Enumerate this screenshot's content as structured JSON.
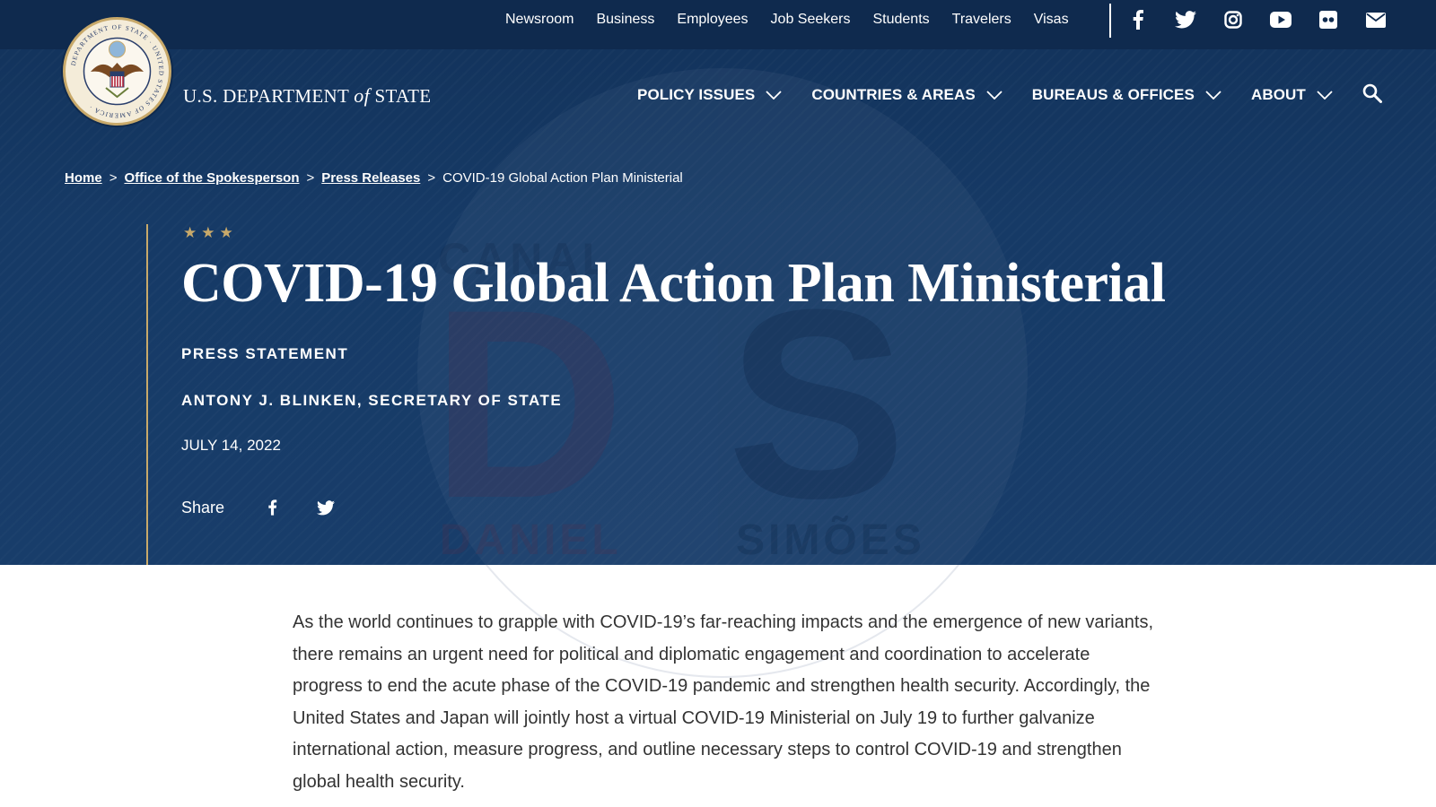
{
  "top_nav": {
    "links": [
      "Newsroom",
      "Business",
      "Employees",
      "Job Seekers",
      "Students",
      "Travelers",
      "Visas"
    ],
    "social_icons": [
      "facebook-icon",
      "twitter-icon",
      "instagram-icon",
      "youtube-icon",
      "flickr-icon",
      "email-icon"
    ]
  },
  "header": {
    "agency_part1": "U.S. DEPARTMENT",
    "agency_of": "of",
    "agency_part2": "STATE",
    "seal_text": "DEPARTMENT OF STATE · UNITED STATES OF AMERICA"
  },
  "main_nav": {
    "items": [
      "POLICY ISSUES",
      "COUNTRIES & AREAS",
      "BUREAUS & OFFICES",
      "ABOUT"
    ],
    "search_icon": "search-icon"
  },
  "breadcrumb": {
    "items": [
      "Home",
      "Office of the Spokesperson",
      "Press Releases"
    ],
    "current": "COVID-19 Global Action Plan Ministerial",
    "separator": ">"
  },
  "article": {
    "stars": "★★★",
    "title": "COVID-19 Global Action Plan Ministerial",
    "kind": "PRESS STATEMENT",
    "author": "ANTONY J. BLINKEN, SECRETARY OF STATE",
    "date": "JULY 14, 2022",
    "share_label": "Share",
    "body": "As the world continues to grapple with COVID-19’s far-reaching impacts and the emergence of new variants, there remains an urgent need for political and diplomatic engagement and coordination to accelerate progress to end the acute phase of the COVID-19 pandemic and strengthen health security. Accordingly, the United States and Japan will jointly host a virtual COVID-19 Ministerial on July 19 to further galvanize international action, measure progress, and outline necessary steps to control COVID-19 and strengthen global health security."
  },
  "watermark": {
    "top": "CANAL",
    "letters": "DS",
    "bottom_left": "DANIEL",
    "bottom_right": "SIMÕES"
  },
  "colors": {
    "navy": "#163a66",
    "topbar": "#0f2a4e",
    "gold": "#c8a96a",
    "body_text": "#333333"
  }
}
